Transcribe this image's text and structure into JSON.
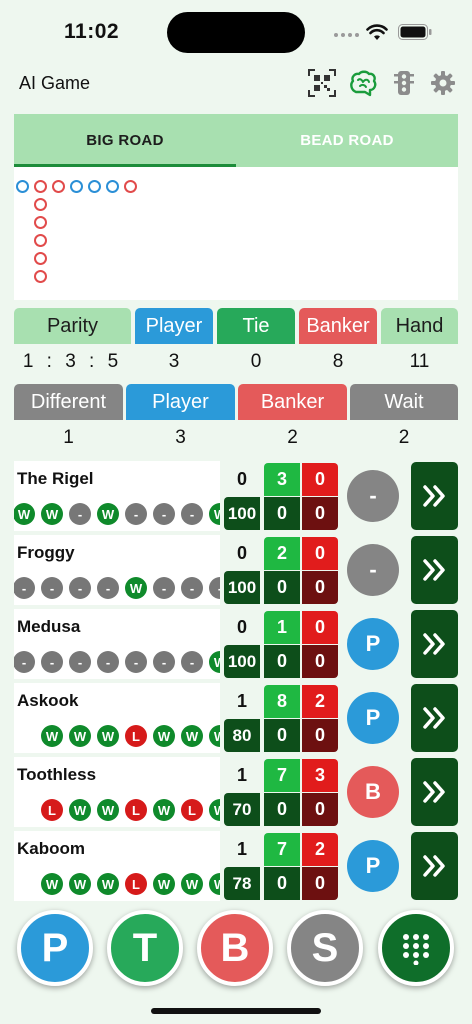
{
  "status": {
    "time": "11:02"
  },
  "nav": {
    "title": "AI Game",
    "icons": [
      "qr-code-icon",
      "brain-icon",
      "traffic-light-icon",
      "gear-icon"
    ]
  },
  "road": {
    "tabs": [
      {
        "label": "BIG ROAD",
        "active": true
      },
      {
        "label": "BEAD ROAD",
        "active": false
      }
    ],
    "beads": [
      {
        "col": 0,
        "row": 0,
        "color": "#2b8fd6"
      },
      {
        "col": 1,
        "row": 0,
        "color": "#e14b4b"
      },
      {
        "col": 1,
        "row": 1,
        "color": "#e14b4b"
      },
      {
        "col": 1,
        "row": 2,
        "color": "#e14b4b"
      },
      {
        "col": 1,
        "row": 3,
        "color": "#e14b4b"
      },
      {
        "col": 1,
        "row": 4,
        "color": "#e14b4b"
      },
      {
        "col": 1,
        "row": 5,
        "color": "#e14b4b"
      },
      {
        "col": 2,
        "row": 0,
        "color": "#e14b4b"
      },
      {
        "col": 3,
        "row": 0,
        "color": "#2b8fd6"
      },
      {
        "col": 4,
        "row": 0,
        "color": "#2b8fd6"
      },
      {
        "col": 5,
        "row": 0,
        "color": "#2b8fd6"
      },
      {
        "col": 6,
        "row": 0,
        "color": "#e14b4b"
      }
    ]
  },
  "stats1": [
    {
      "label": "Parity",
      "value": "1 : 3 : 5",
      "bg": "#a8e0b0",
      "fg": "#1d1d1d"
    },
    {
      "label": "Player",
      "value": "3",
      "bg": "#2b9ad9",
      "fg": "#ffffff"
    },
    {
      "label": "Tie",
      "value": "0",
      "bg": "#27a95a",
      "fg": "#ffffff"
    },
    {
      "label": "Banker",
      "value": "8",
      "bg": "#e45a5a",
      "fg": "#ffffff"
    },
    {
      "label": "Hand",
      "value": "11",
      "bg": "#a8e0b0",
      "fg": "#1d1d1d"
    }
  ],
  "stats2": [
    {
      "label": "Different",
      "value": "1",
      "bg": "#858585"
    },
    {
      "label": "Player",
      "value": "3",
      "bg": "#2b9ad9"
    },
    {
      "label": "Banker",
      "value": "2",
      "bg": "#e45a5a"
    },
    {
      "label": "Wait",
      "value": "2",
      "bg": "#858585"
    }
  ],
  "bots": [
    {
      "name": "The Rigel",
      "count": "0",
      "progress": "100",
      "win1": "3",
      "loss1": "0",
      "win2": "0",
      "loss2": "0",
      "prediction": "-",
      "pred_color": "#858585",
      "history": [
        "W",
        "W",
        "-",
        "W",
        "-",
        "-",
        "-",
        "W"
      ]
    },
    {
      "name": "Froggy",
      "count": "0",
      "progress": "100",
      "win1": "2",
      "loss1": "0",
      "win2": "0",
      "loss2": "0",
      "prediction": "-",
      "pred_color": "#858585",
      "history": [
        "-",
        "-",
        "-",
        "-",
        "W",
        "-",
        "-",
        "-"
      ]
    },
    {
      "name": "Medusa",
      "count": "0",
      "progress": "100",
      "win1": "1",
      "loss1": "0",
      "win2": "0",
      "loss2": "0",
      "prediction": "P",
      "pred_color": "#2b9ad9",
      "history": [
        "-",
        "-",
        "-",
        "-",
        "-",
        "-",
        "-",
        "-",
        "W"
      ]
    },
    {
      "name": "Askook",
      "count": "1",
      "progress": "80",
      "win1": "8",
      "loss1": "2",
      "win2": "0",
      "loss2": "0",
      "prediction": "P",
      "pred_color": "#2b9ad9",
      "history": [
        "W",
        "W",
        "W",
        "L",
        "W",
        "W",
        "W"
      ]
    },
    {
      "name": "Toothless",
      "count": "1",
      "progress": "70",
      "win1": "7",
      "loss1": "3",
      "win2": "0",
      "loss2": "0",
      "prediction": "B",
      "pred_color": "#e45a5a",
      "history": [
        "L",
        "W",
        "W",
        "L",
        "W",
        "L",
        "W"
      ]
    },
    {
      "name": "Kaboom",
      "count": "1",
      "progress": "78",
      "win1": "7",
      "loss1": "2",
      "win2": "0",
      "loss2": "0",
      "prediction": "P",
      "pred_color": "#2b9ad9",
      "history": [
        "W",
        "W",
        "W",
        "L",
        "W",
        "W",
        "W"
      ]
    }
  ],
  "bottom": [
    {
      "label": "P",
      "name": "player-bet-button",
      "color": "#2b9ad9"
    },
    {
      "label": "T",
      "name": "tie-bet-button",
      "color": "#27a95a"
    },
    {
      "label": "B",
      "name": "banker-bet-button",
      "color": "#e45a5a"
    },
    {
      "label": "S",
      "name": "skip-button",
      "color": "#858585"
    },
    {
      "label": "",
      "name": "keypad-button",
      "color": "#0f6e2a",
      "icon": "keypad-grid-icon"
    }
  ],
  "colors": {
    "win": "#0f8a2b",
    "loss": "#d61a1a",
    "none": "#777777"
  }
}
